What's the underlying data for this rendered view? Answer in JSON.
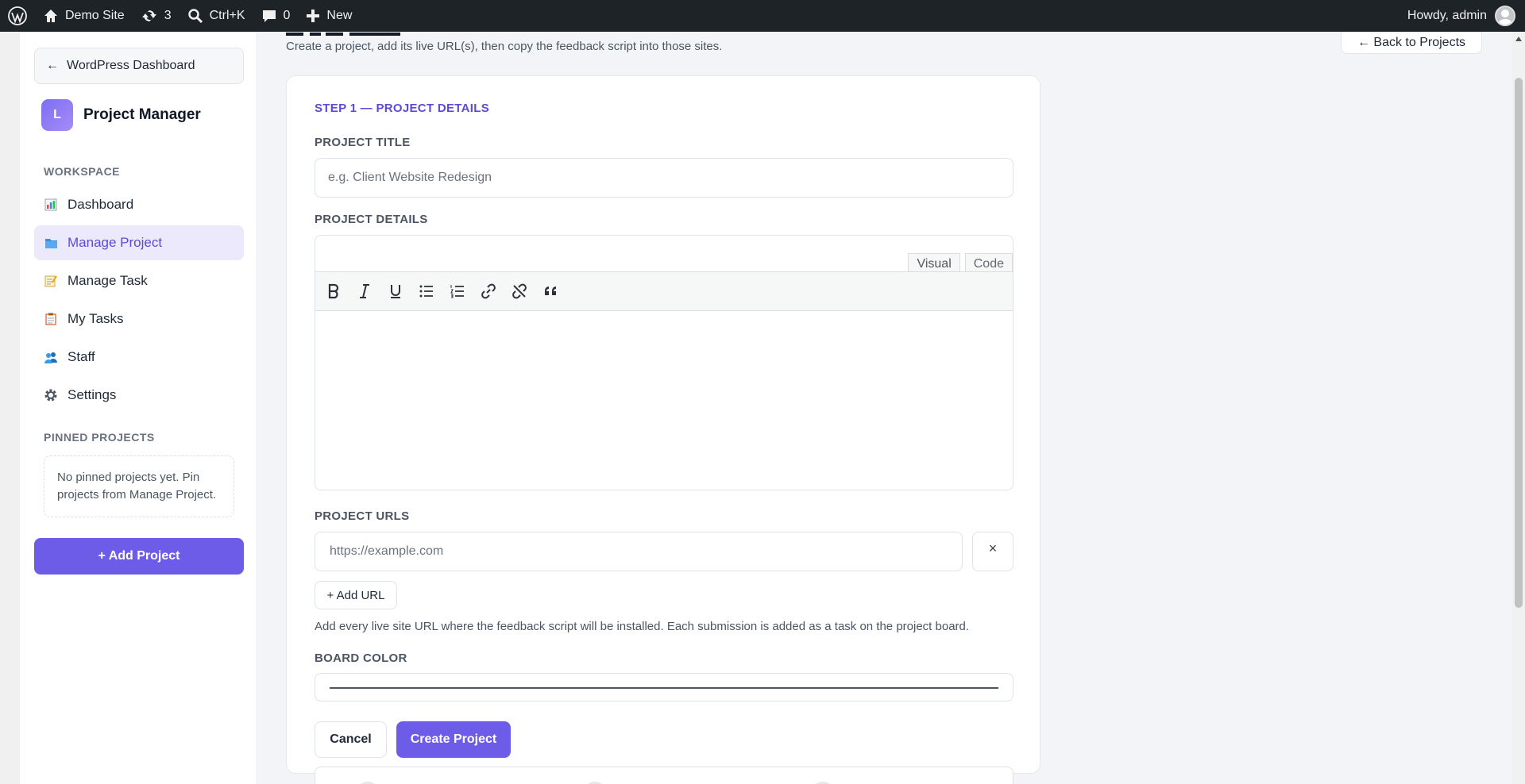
{
  "adminbar": {
    "site_name": "Demo Site",
    "updates_count": "3",
    "search_shortcut": "Ctrl+K",
    "comments_count": "0",
    "new_label": "New",
    "howdy": "Howdy, admin"
  },
  "sidebar": {
    "wp_dashboard_label": "WordPress Dashboard",
    "brand_initial": "L",
    "brand_name": "Project Manager",
    "workspace_label": "WORKSPACE",
    "items": [
      {
        "label": "Dashboard",
        "icon": "bar-chart-icon"
      },
      {
        "label": "Manage Project",
        "icon": "folder-icon"
      },
      {
        "label": "Manage Task",
        "icon": "memo-icon"
      },
      {
        "label": "My Tasks",
        "icon": "clipboard-icon"
      },
      {
        "label": "Staff",
        "icon": "people-icon"
      },
      {
        "label": "Settings",
        "icon": "gear-icon"
      }
    ],
    "pinned_label": "PINNED PROJECTS",
    "pinned_empty": "No pinned projects yet. Pin projects from Manage Project.",
    "add_project_label": "+ Add Project"
  },
  "page": {
    "subtitle": "Create a project, add its live URL(s), then copy the feedback script into those sites.",
    "back_label": "← Back to Projects"
  },
  "form": {
    "step_title": "STEP 1 — PROJECT DETAILS",
    "title_label": "PROJECT TITLE",
    "title_placeholder": "e.g. Client Website Redesign",
    "details_label": "PROJECT DETAILS",
    "tab_visual": "Visual",
    "tab_code": "Code",
    "urls_label": "PROJECT URLS",
    "url_placeholder": "https://example.com",
    "remove_url": "×",
    "add_url_label": "+ Add URL",
    "url_help": "Add every live site URL where the feedback script will be installed. Each submission is added as a task on the project board.",
    "board_color_label": "BOARD COLOR",
    "cancel_label": "Cancel",
    "create_label": "Create Project"
  }
}
